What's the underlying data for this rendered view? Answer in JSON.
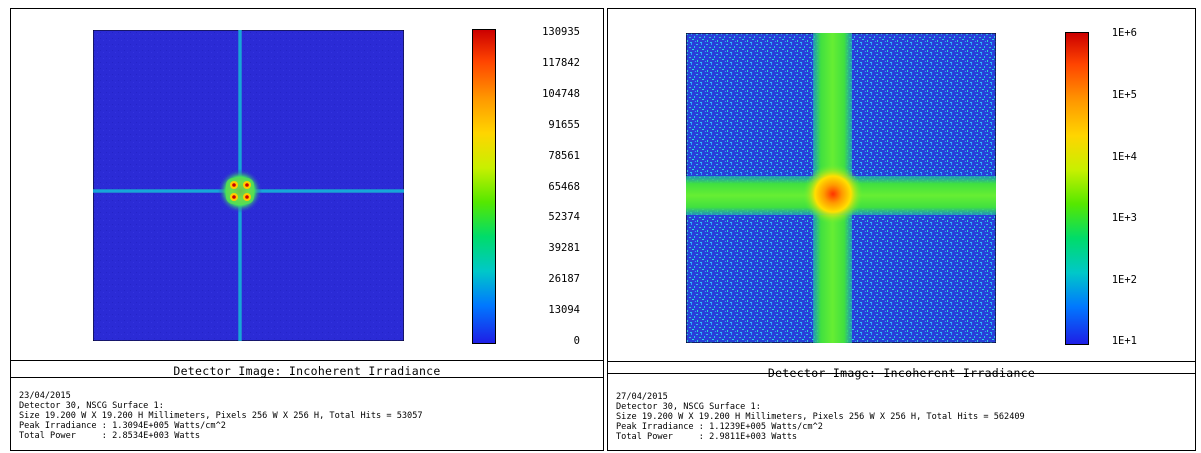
{
  "left_panel": {
    "title": "Detector Image: Incoherent Irradiance",
    "colorbar_ticks": [
      "130935",
      "117842",
      "104748",
      "91655",
      "78561",
      "65468",
      "52374",
      "39281",
      "26187",
      "13094",
      "0"
    ],
    "info": {
      "date": "23/04/2015",
      "detector": "Detector 30, NSCG Surface 1:",
      "size": "Size 19.200 W X 19.200 H Millimeters, Pixels 256 W X 256 H, Total Hits = 53057",
      "peak": "Peak Irradiance : 1.3094E+005 Watts/cm^2",
      "power": "Total Power     : 2.8534E+003 Watts"
    }
  },
  "right_panel": {
    "title": "Detector Image: Incoherent Irradiance",
    "colorbar_ticks": [
      "1E+6",
      "1E+5",
      "1E+4",
      "1E+3",
      "1E+2",
      "1E+1"
    ],
    "info": {
      "date": "27/04/2015",
      "detector": "Detector 30, NSCG Surface 1:",
      "size": "Size 19.200 W X 19.200 H Millimeters, Pixels 256 W X 256 H, Total Hits = 562409",
      "peak": "Peak Irradiance : 1.1239E+005 Watts/cm^2",
      "power": "Total Power     : 2.9811E+003 Watts"
    }
  },
  "colors": {
    "background_blue": "#2b2bd6",
    "colorbar_top": "#cc0000",
    "colorbar_bottom": "#1e1ee6"
  }
}
